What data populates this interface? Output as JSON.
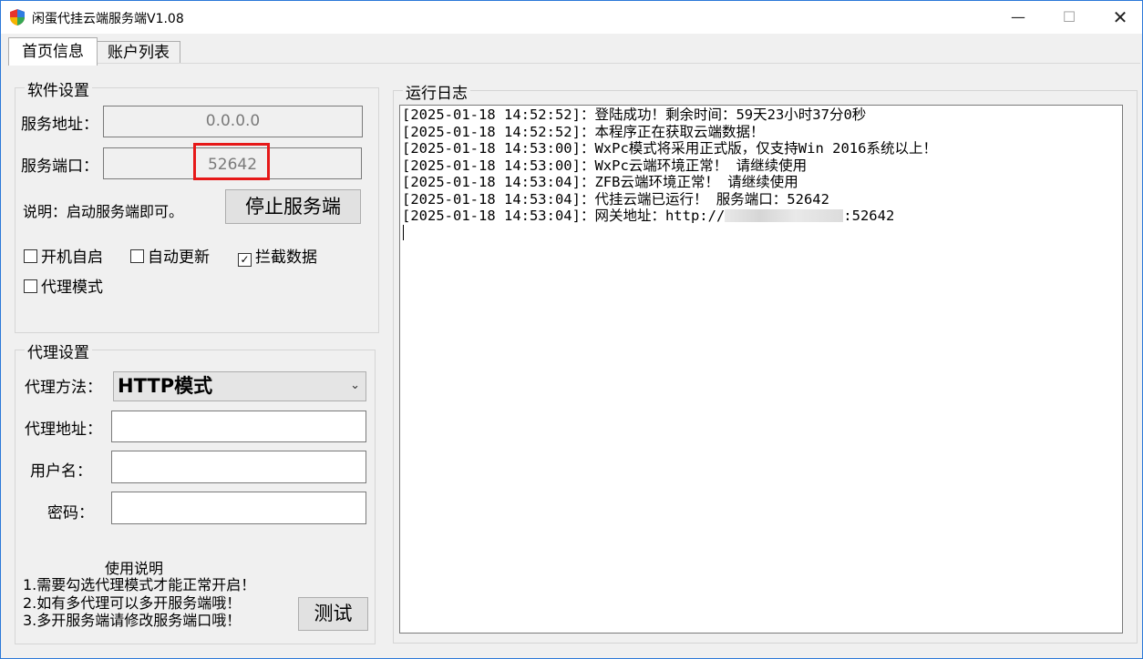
{
  "window": {
    "title": "闲蛋代挂云端服务端V1.08",
    "controls": {
      "minimize": "—",
      "maximize": "☐",
      "close": "✕"
    }
  },
  "tabs": [
    {
      "label": "首页信息",
      "active": true
    },
    {
      "label": "账户列表",
      "active": false
    }
  ],
  "software_settings": {
    "legend": "软件设置",
    "address_label": "服务地址：",
    "address_value": "0.0.0.0",
    "port_label": "服务端口：",
    "port_value": "52642",
    "note": "说明：启动服务端即可。",
    "stop_button": "停止服务端",
    "checkboxes": [
      {
        "label": "开机自启",
        "checked": false
      },
      {
        "label": "自动更新",
        "checked": false
      },
      {
        "label": "拦截数据",
        "checked": true
      },
      {
        "label": "代理模式",
        "checked": false
      }
    ]
  },
  "proxy_settings": {
    "legend": "代理设置",
    "method_label": "代理方法：",
    "method_value": "HTTP模式",
    "address_label": "代理地址：",
    "address_value": "",
    "username_label": "用户名：",
    "username_value": "",
    "password_label": "密码：",
    "password_value": "",
    "instructions_title": "使用说明",
    "instructions": [
      "1.需要勾选代理模式才能正常开启！",
      "2.如有多代理可以多开服务端哦！",
      "3.多开服务端请修改服务端口哦！"
    ],
    "test_button": "测试"
  },
  "log": {
    "legend": "运行日志",
    "lines": [
      "[2025-01-18 14:52:52]：登陆成功！剩余时间：59天23小时37分0秒",
      "[2025-01-18 14:52:52]：本程序正在获取云端数据！",
      "[2025-01-18 14:53:00]：WxPc模式将采用正式版，仅支持Win 2016系统以上！",
      "[2025-01-18 14:53:00]：WxPc云端环境正常！ 请继续使用",
      "[2025-01-18 14:53:04]：ZFB云端环境正常！ 请继续使用",
      "[2025-01-18 14:53:04]：代挂云端已运行！ 服务端口：52642"
    ],
    "gateway_prefix": "[2025-01-18 14:53:04]：网关地址：http://",
    "gateway_suffix": ":52642"
  },
  "colors": {
    "highlight": "#e61919",
    "accent": "#2b78d8"
  }
}
